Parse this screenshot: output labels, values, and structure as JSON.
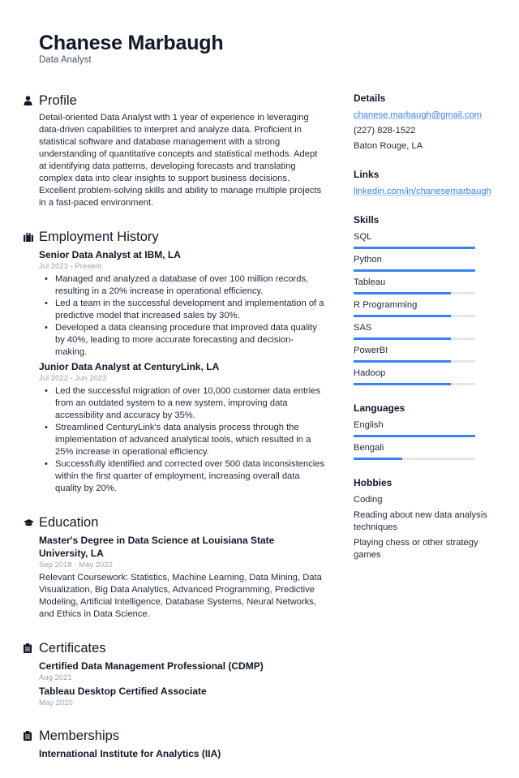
{
  "header": {
    "name": "Chanese Marbaugh",
    "title": "Data Analyst"
  },
  "profile": {
    "heading": "Profile",
    "icon": "person-icon",
    "text": "Detail-oriented Data Analyst with 1 year of experience in leveraging data-driven capabilities to interpret and analyze data. Proficient in statistical software and database management with a strong understanding of quantitative concepts and statistical methods. Adept at identifying data patterns, developing forecasts and translating complex data into clear insights to support business decisions. Excellent problem-solving skills and ability to manage multiple projects in a fast-paced environment."
  },
  "employment": {
    "heading": "Employment History",
    "icon": "briefcase-icon",
    "jobs": [
      {
        "title": "Senior Data Analyst at IBM, LA",
        "dates": "Jul 2023 - Present",
        "bullets": [
          "Managed and analyzed a database of over 100 million records, resulting in a 20% increase in operational efficiency.",
          "Led a team in the successful development and implementation of a predictive model that increased sales by 30%.",
          "Developed a data cleansing procedure that improved data quality by 40%, leading to more accurate forecasting and decision-making."
        ]
      },
      {
        "title": "Junior Data Analyst at CenturyLink, LA",
        "dates": "Jul 2022 - Jun 2023",
        "bullets": [
          "Led the successful migration of over 10,000 customer data entries from an outdated system to a new system, improving data accessibility and accuracy by 35%.",
          "Streamlined CenturyLink's data analysis process through the implementation of advanced analytical tools, which resulted in a 25% increase in operational efficiency.",
          "Successfully identified and corrected over 500 data inconsistencies within the first quarter of employment, increasing overall data quality by 20%."
        ]
      }
    ]
  },
  "education": {
    "heading": "Education",
    "icon": "graduation-cap-icon",
    "entries": [
      {
        "title": "Master's Degree in Data Science at Louisiana State University, LA",
        "dates": "Sep 2018 - May 2022",
        "description": "Relevant Coursework: Statistics, Machine Learning, Data Mining, Data Visualization, Big Data Analytics, Advanced Programming, Predictive Modeling, Artificial Intelligence, Database Systems, Neural Networks, and Ethics in Data Science."
      }
    ]
  },
  "certificates": {
    "heading": "Certificates",
    "icon": "clipboard-icon",
    "entries": [
      {
        "title": "Certified Data Management Professional (CDMP)",
        "date": "Aug 2021"
      },
      {
        "title": "Tableau Desktop Certified Associate",
        "date": "May 2020"
      }
    ]
  },
  "memberships": {
    "heading": "Memberships",
    "icon": "clipboard-icon",
    "entries": [
      {
        "title": "International Institute for Analytics (IIA)"
      }
    ]
  },
  "details": {
    "heading": "Details",
    "email": "chanese.marbaugh@gmail.com",
    "phone": "(227) 828-1522",
    "location": "Baton Rouge, LA"
  },
  "links": {
    "heading": "Links",
    "items": [
      "linkedin.com/in/chanesemarbaugh"
    ]
  },
  "skills": {
    "heading": "Skills",
    "items": [
      {
        "name": "SQL",
        "level": 1.0
      },
      {
        "name": "Python",
        "level": 1.0
      },
      {
        "name": "Tableau",
        "level": 0.8
      },
      {
        "name": "R Programming",
        "level": 0.8
      },
      {
        "name": "SAS",
        "level": 0.8
      },
      {
        "name": "PowerBI",
        "level": 0.8
      },
      {
        "name": "Hadoop",
        "level": 0.8
      }
    ]
  },
  "languages": {
    "heading": "Languages",
    "items": [
      {
        "name": "English",
        "level": 1.0
      },
      {
        "name": "Bengali",
        "level": 0.4
      }
    ]
  },
  "hobbies": {
    "heading": "Hobbies",
    "items": [
      "Coding",
      "Reading about new data analysis techniques",
      "Playing chess or other strategy games"
    ]
  },
  "colors": {
    "accent": "#3b82f6",
    "bar_track": "#e5e7eb",
    "text": "#1f2937",
    "muted": "#9ca3af"
  }
}
